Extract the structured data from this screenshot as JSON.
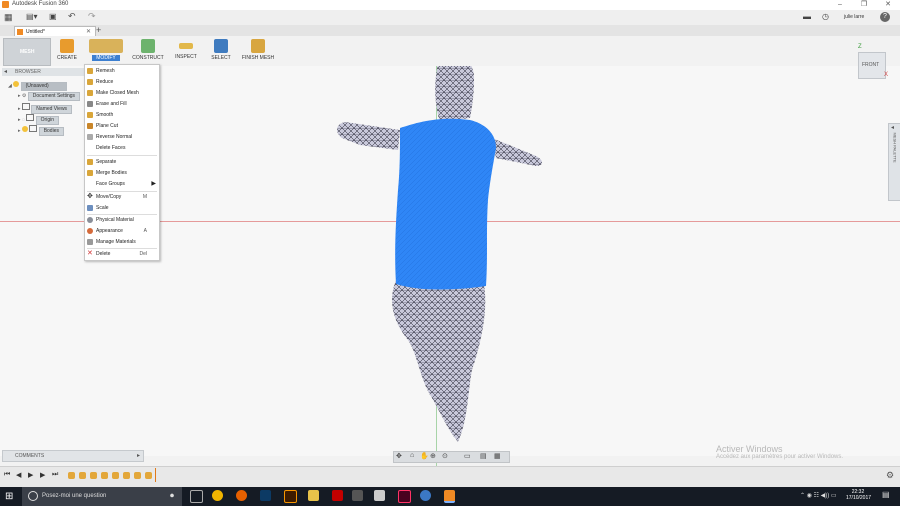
{
  "app": {
    "title": "Autodesk Fusion 360"
  },
  "appbar": {
    "user": "julie larre",
    "help": "?"
  },
  "document": {
    "tab_label": "Untitled*",
    "add_tab": "+"
  },
  "ribbon": {
    "workspace": "MESH",
    "groups": [
      "CREATE",
      "MODIFY",
      "CONSTRUCT",
      "INSPECT",
      "SELECT",
      "FINISH MESH"
    ]
  },
  "browser": {
    "title": "BROWSER",
    "root": "(Unsaved)",
    "nodes": [
      "Document Settings",
      "Named Views",
      "Origin",
      "Bodies"
    ]
  },
  "menu": {
    "items": [
      {
        "label": "Remesh",
        "shortcut": ""
      },
      {
        "label": "Reduce",
        "shortcut": ""
      },
      {
        "label": "Make Closed Mesh",
        "shortcut": ""
      },
      {
        "label": "Erase and Fill",
        "shortcut": ""
      },
      {
        "label": "Smooth",
        "shortcut": ""
      },
      {
        "label": "Plane Cut",
        "shortcut": ""
      },
      {
        "label": "Reverse Normal",
        "shortcut": ""
      },
      {
        "label": "Delete Faces",
        "shortcut": ""
      },
      {
        "label": "Separate",
        "shortcut": ""
      },
      {
        "label": "Merge Bodies",
        "shortcut": ""
      },
      {
        "label": "Face Groups",
        "shortcut": ""
      },
      {
        "label": "Move/Copy",
        "shortcut": "M"
      },
      {
        "label": "Scale",
        "shortcut": ""
      },
      {
        "label": "Physical Material",
        "shortcut": ""
      },
      {
        "label": "Appearance",
        "shortcut": "A"
      },
      {
        "label": "Manage Materials",
        "shortcut": ""
      },
      {
        "label": "Delete",
        "shortcut": "Del"
      }
    ]
  },
  "viewcube": {
    "face": "FRONT",
    "axis_z": "Z",
    "axis_x": "X"
  },
  "side_panel": {
    "label": "MESH PALETTE"
  },
  "comments": {
    "label": "COMMENTS"
  },
  "watermark": {
    "title": "Activer Windows",
    "subtitle": "Accédez aux paramètres pour activer Windows."
  },
  "taskbar": {
    "search_placeholder": "Posez-moi une question",
    "time": "22:32",
    "date": "17/10/2017"
  },
  "colors": {
    "accent": "#2f86f6",
    "mesh_blue": "#2f86f6",
    "mesh_grey": "#c8c8da",
    "taskbar": "#151b24"
  }
}
